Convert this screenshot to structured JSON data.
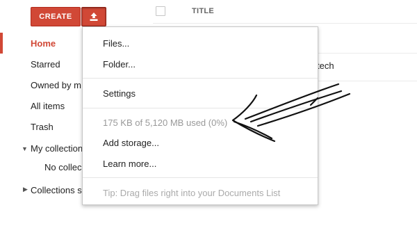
{
  "toolbar": {
    "create_label": "CREATE",
    "upload_icon": "upload-icon"
  },
  "table": {
    "title_header": "TITLE",
    "visible_fragment": "tech"
  },
  "sidebar": {
    "items": [
      {
        "label": "Home",
        "active": true
      },
      {
        "label": "Starred"
      },
      {
        "label": "Owned by m"
      },
      {
        "label": "All items"
      },
      {
        "label": "Trash"
      },
      {
        "label": "My collection",
        "expandable": true,
        "expanded": true
      },
      {
        "label": "No collec"
      },
      {
        "label": "Collections s",
        "expandable": true,
        "expanded": false
      }
    ]
  },
  "upload_menu": {
    "items": {
      "files": "Files...",
      "folder": "Folder...",
      "settings": "Settings",
      "add_storage": "Add storage...",
      "learn_more": "Learn more..."
    },
    "storage_usage": "175 KB of 5,120 MB used (0%)",
    "tip": "Tip: Drag files right into your Documents List"
  },
  "colors": {
    "accent": "#d14836",
    "muted_text": "#999999",
    "annotation": "#111111"
  }
}
